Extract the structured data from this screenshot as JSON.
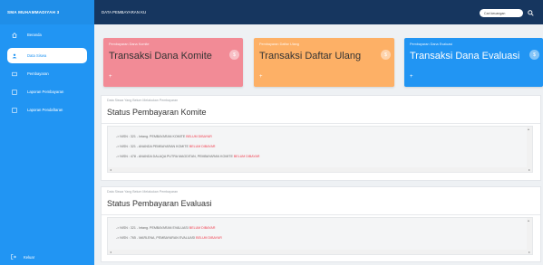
{
  "sidebar": {
    "brand": "SMA MUHAMMADIYAH 3",
    "items": [
      {
        "label": "Beranda",
        "icon": "home-icon"
      },
      {
        "label": "Data Siswa",
        "icon": "user-icon",
        "active": true
      },
      {
        "label": "Pembayaran",
        "icon": "money-icon"
      },
      {
        "label": "Laporan Pembayaran",
        "icon": "report-icon"
      },
      {
        "label": "Laporan Pendaftaran",
        "icon": "report-icon"
      }
    ],
    "logout": "Keluar"
  },
  "topbar": {
    "title": "DATA PEMBAYARAN KU",
    "search_placeholder": "Cari keuangan",
    "search_icon": "search-icon"
  },
  "cards": [
    {
      "sub": "Pembayaran Dana Komite",
      "title": "Transaksi Dana Komite",
      "color": "#f28b96"
    },
    {
      "sub": "Pembayaran Daftar Ulang",
      "title": "Transaksi Daftar Ulang",
      "color": "#fdb066"
    },
    {
      "sub": "Pembayaran Dana Evaluasi",
      "title": "Transaksi Dana Evaluasi",
      "color": "#2195f3"
    }
  ],
  "panels": [
    {
      "caption": "Data Siswa Yang Belum Melakukan Pembayaran",
      "heading": "Status Pembayaran Komite",
      "rows": [
        {
          "text": "-> NISN : 321 - Intang. PEMBAYARAN KOMITE ",
          "status": "BELUM DIBAYAR"
        },
        {
          "text": "-> NISN : 321 - ANANDA PEMBAYARAN KOMITE ",
          "status": "BELUM DIBAYAR"
        },
        {
          "text": "-> NISN : 478 - ANANDA DALAQA PUTRA MAGDITAN, PEMBAYARAN KOMITE ",
          "status": "BELUM DIBAYAR"
        }
      ]
    },
    {
      "caption": "Data Siswa Yang Belum Melakukan Pembayaran",
      "heading": "Status Pembayaran Evaluasi",
      "rows": [
        {
          "text": "-> NISN : 321 - Intang. PEMBAYARAN EVALUASI ",
          "status": "BELUM DIBAYAR"
        },
        {
          "text": "-> NISN : 765 - MARLENA, PEMBAYARAN EVALUASI ",
          "status": "BELUM DIBAYAR"
        }
      ]
    }
  ]
}
